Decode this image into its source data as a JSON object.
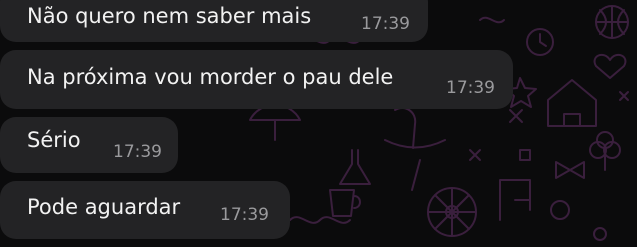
{
  "chat": {
    "messages": [
      {
        "text": "Não quero nem saber mais",
        "time": "17:39"
      },
      {
        "text": "Na próxima vou morder o pau dele",
        "time": "17:39"
      },
      {
        "text": "Sério",
        "time": "17:39"
      },
      {
        "text": "Pode aguardar",
        "time": "17:39"
      }
    ]
  },
  "theme": {
    "background": "#0b0b0c",
    "bubble": "#232325",
    "text": "#f2f2f2",
    "timestamp": "#9a9a9d",
    "wallpaper_doodles": "#3a1f3d"
  }
}
